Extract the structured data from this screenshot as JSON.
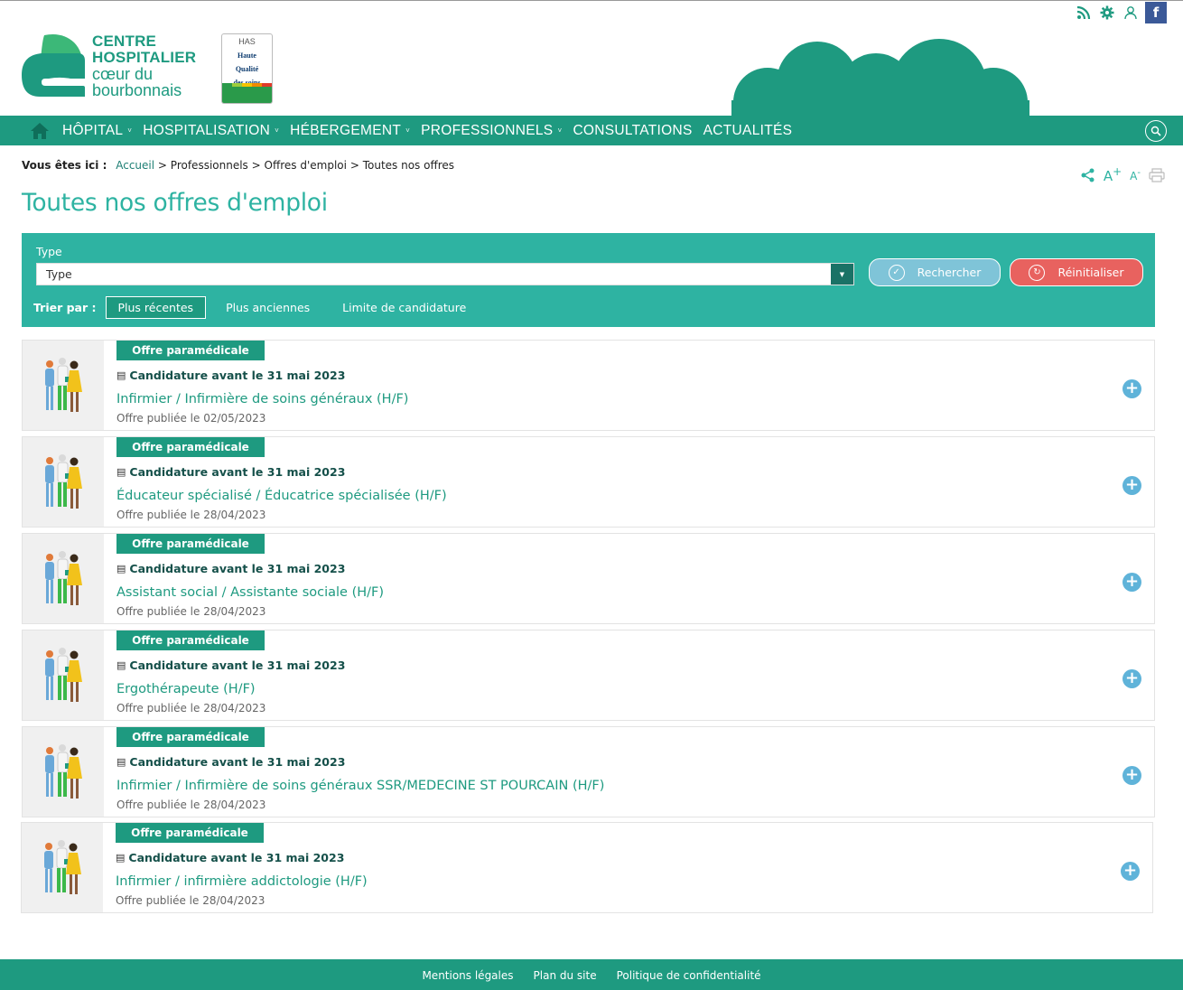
{
  "topbar": {
    "icons": [
      "rss-icon",
      "gear-icon",
      "user-icon",
      "facebook-icon"
    ],
    "facebook_glyph": "f"
  },
  "logo": {
    "line1": "CENTRE",
    "line2": "HOSPITALIER",
    "line3": "cœur du",
    "line4": "bourbonnais"
  },
  "has_badge": {
    "brand": "HAS",
    "line1": "Haute",
    "line2": "Qualité",
    "line3": "des soins"
  },
  "nav": {
    "items": [
      {
        "label": "HÔPITAL",
        "chevron": "˅"
      },
      {
        "label": "HOSPITALISATION",
        "chevron": "˅"
      },
      {
        "label": "HÉBERGEMENT",
        "chevron": "˅"
      },
      {
        "label": "PROFESSIONNELS",
        "chevron": "˅"
      },
      {
        "label": "CONSULTATIONS",
        "chevron": ""
      },
      {
        "label": "ACTUALITÉS",
        "chevron": ""
      }
    ]
  },
  "breadcrumb": {
    "label": "Vous êtes ici :",
    "home": "Accueil",
    "sep": ">",
    "path1": "Professionnels",
    "path2": "Offres d'emploi",
    "current": "Toutes nos offres"
  },
  "tools": {
    "font_bigger": "A",
    "font_smaller": "A",
    "plus_sup": "+",
    "minus_sup": "-"
  },
  "page": {
    "title": "Toutes nos offres d'emploi"
  },
  "filter": {
    "type_label": "Type",
    "type_value": "Type",
    "search_label": "Rechercher",
    "reset_label": "Réinitialiser",
    "sort_label": "Trier par :",
    "sort_options": [
      "Plus récentes",
      "Plus anciennes",
      "Limite de candidature"
    ],
    "sort_active": 0
  },
  "offers": [
    {
      "badge": "Offre paramédicale",
      "deadline": "Candidature avant le 31 mai 2023",
      "title": "Infirmier / Infirmière de soins généraux (H/F)",
      "published": "Offre publiée le 02/05/2023"
    },
    {
      "badge": "Offre paramédicale",
      "deadline": "Candidature avant le 31 mai 2023",
      "title": "Éducateur spécialisé / Éducatrice spécialisée (H/F)",
      "published": "Offre publiée le 28/04/2023"
    },
    {
      "badge": "Offre paramédicale",
      "deadline": "Candidature avant le 31 mai 2023",
      "title": "Assistant social / Assistante sociale (H/F)",
      "published": "Offre publiée le 28/04/2023"
    },
    {
      "badge": "Offre paramédicale",
      "deadline": "Candidature avant le 31 mai 2023",
      "title": "Ergothérapeute (H/F)",
      "published": "Offre publiée le 28/04/2023"
    },
    {
      "badge": "Offre paramédicale",
      "deadline": "Candidature avant le 31 mai 2023",
      "title": "Infirmier / Infirmière de soins généraux SSR/MEDECINE ST POURCAIN (H/F)",
      "published": "Offre publiée le 28/04/2023"
    },
    {
      "badge": "Offre paramédicale",
      "deadline": "Candidature avant le 31 mai 2023",
      "title": "Infirmier / infirmière addictologie (H/F)",
      "published": "Offre publiée le 28/04/2023"
    }
  ],
  "footer": {
    "links": [
      "Mentions légales",
      "Plan du site",
      "Politique de confidentialité"
    ]
  },
  "colors": {
    "primary": "#1e9a80",
    "accent": "#2eb3a2",
    "search_button": "#7fc4d8",
    "reset_button": "#e8625f"
  }
}
